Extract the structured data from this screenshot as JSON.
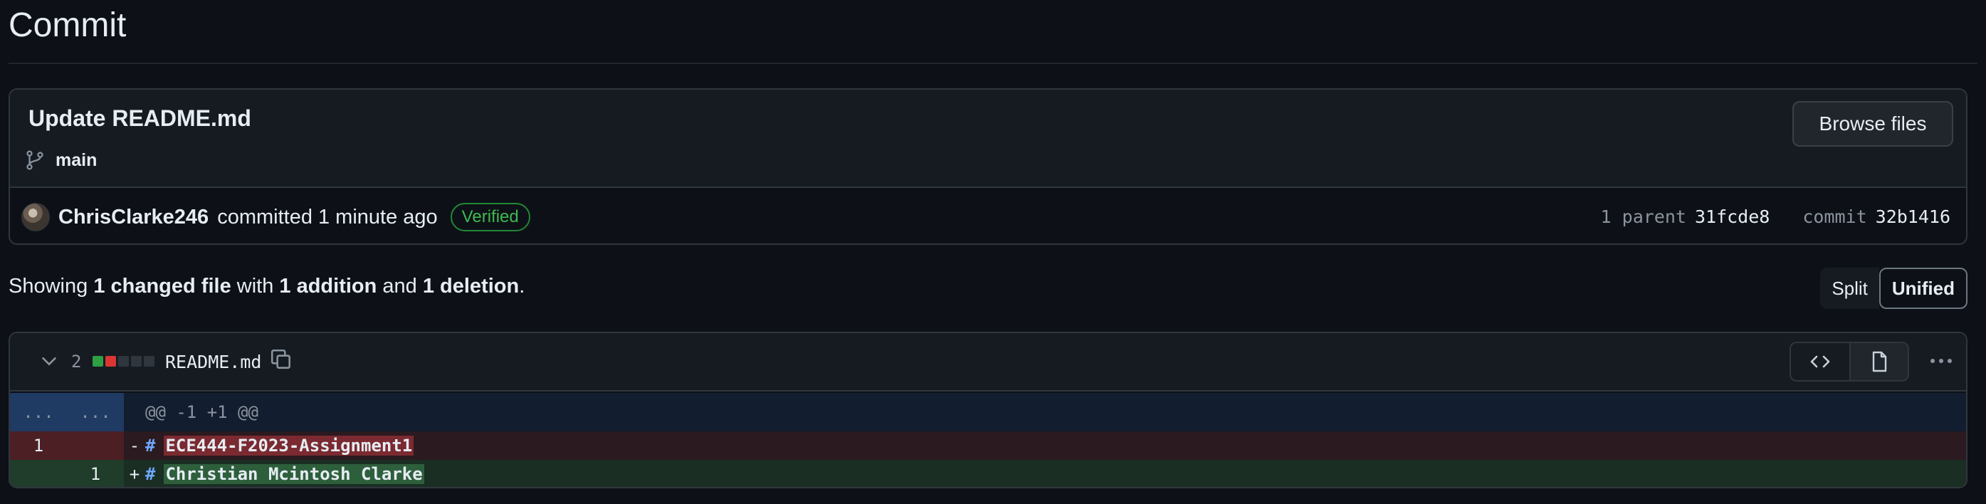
{
  "header": {
    "title": "Commit"
  },
  "commit": {
    "message": "Update README.md",
    "branch": "main",
    "browse_label": "Browse files",
    "author": "ChrisClarke246",
    "action": "committed 1 minute ago",
    "verified": "Verified",
    "parent_label": "1 parent",
    "parent_sha": "31fcde8",
    "commit_label": "commit",
    "commit_sha": "32b1416"
  },
  "summary": {
    "prefix": "Showing ",
    "files": "1 changed file",
    "with": " with ",
    "additions": "1 addition",
    "and": " and ",
    "deletions": "1 deletion",
    "suffix": "."
  },
  "view_toggle": {
    "split": "Split",
    "unified": "Unified",
    "selected": "Unified"
  },
  "file": {
    "changes": "2",
    "name": "README.md",
    "diffstat": {
      "added": 1,
      "deleted": 1,
      "neutral": 3
    },
    "hunk": {
      "old_num": "...",
      "new_num": "...",
      "header": "@@ -1 +1 @@"
    },
    "lines": [
      {
        "type": "deletion",
        "old_num": "1",
        "new_num": "",
        "sign": "-",
        "hash": "#",
        "text": "ECE444-F2023-Assignment1"
      },
      {
        "type": "addition",
        "old_num": "",
        "new_num": "1",
        "sign": "+",
        "hash": "#",
        "text": "Christian Mcintosh Clarke"
      }
    ]
  },
  "colors": {
    "background": "#0d1117",
    "verified": "#3fb950",
    "deletion": "#da3633",
    "addition": "#2ea043"
  }
}
